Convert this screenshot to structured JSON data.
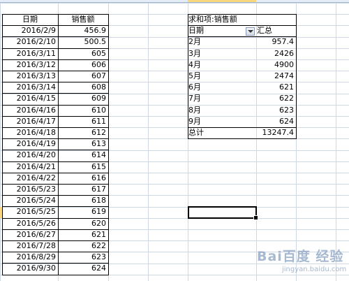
{
  "left_table": {
    "headers": [
      "日期",
      "销售额"
    ],
    "rows": [
      [
        "2016/2/9",
        "456.9"
      ],
      [
        "2016/2/10",
        "500.5"
      ],
      [
        "2016/3/11",
        "605"
      ],
      [
        "2016/3/12",
        "606"
      ],
      [
        "2016/3/13",
        "607"
      ],
      [
        "2016/3/14",
        "608"
      ],
      [
        "2016/4/15",
        "609"
      ],
      [
        "2016/4/16",
        "610"
      ],
      [
        "2016/4/17",
        "611"
      ],
      [
        "2016/4/18",
        "612"
      ],
      [
        "2016/4/19",
        "613"
      ],
      [
        "2016/4/20",
        "614"
      ],
      [
        "2016/4/21",
        "615"
      ],
      [
        "2016/4/22",
        "616"
      ],
      [
        "2016/5/23",
        "617"
      ],
      [
        "2016/5/24",
        "618"
      ],
      [
        "2016/5/25",
        "619"
      ],
      [
        "2016/5/26",
        "620"
      ],
      [
        "2016/6/27",
        "621"
      ],
      [
        "2016/7/28",
        "622"
      ],
      [
        "2016/8/29",
        "623"
      ],
      [
        "2016/9/30",
        "624"
      ]
    ]
  },
  "pivot": {
    "title": "求和项:销售额",
    "row_label": "日期",
    "value_label": "汇总",
    "rows": [
      [
        "2月",
        "957.4"
      ],
      [
        "3月",
        "2426"
      ],
      [
        "4月",
        "4900"
      ],
      [
        "5月",
        "2474"
      ],
      [
        "6月",
        "621"
      ],
      [
        "7月",
        "622"
      ],
      [
        "8月",
        "623"
      ],
      [
        "9月",
        "624"
      ]
    ],
    "total_label": "总计",
    "total_value": "13247.4",
    "filter_icon": "dropdown-arrow-icon"
  },
  "watermark": {
    "title": "Bai百度 经验",
    "url": "jingyan.baidu.com"
  },
  "colors": {
    "gridline": "#d0d7e5",
    "header_strip": "#e4ecf7",
    "selected_header": "#f8d77e",
    "watermark": "#8aa2c2"
  }
}
